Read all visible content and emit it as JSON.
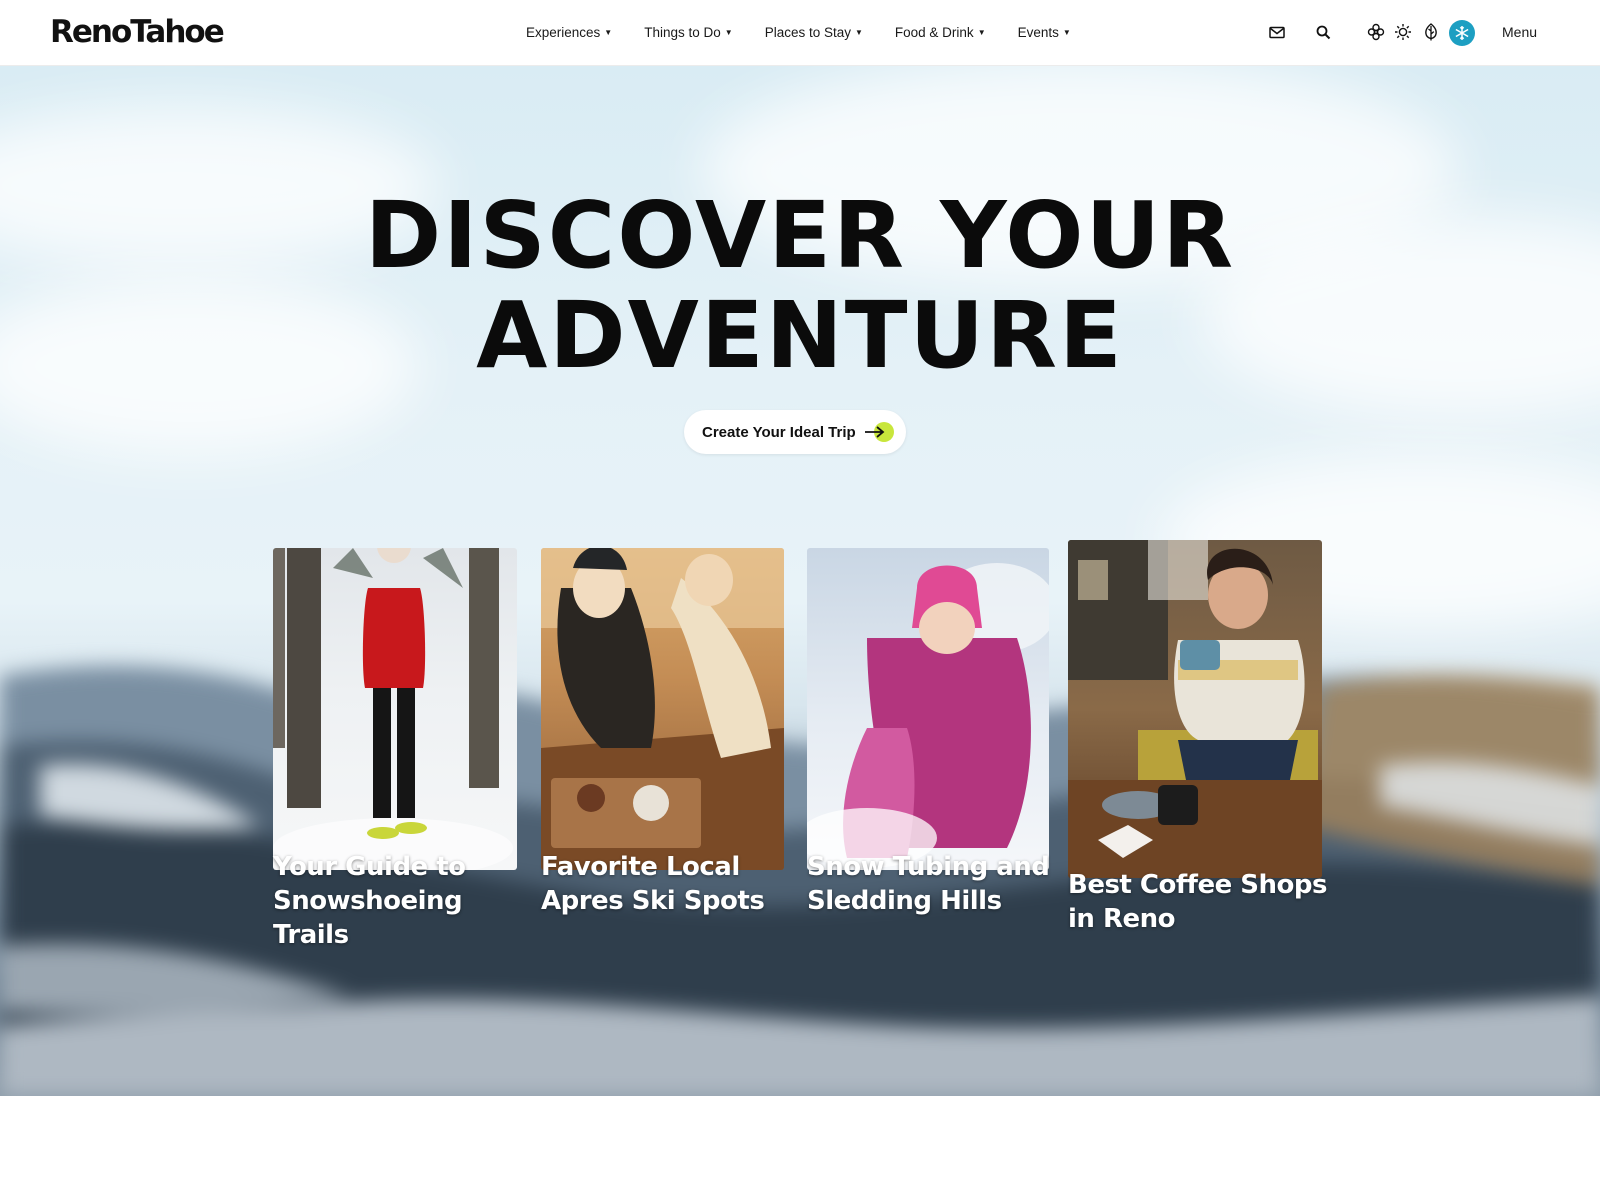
{
  "brand": {
    "logo_text": "RenoTahoe"
  },
  "nav": {
    "items": [
      {
        "label": "Experiences"
      },
      {
        "label": "Things to Do"
      },
      {
        "label": "Places to Stay"
      },
      {
        "label": "Food & Drink"
      },
      {
        "label": "Events"
      }
    ]
  },
  "header_icons": [
    "mail-icon",
    "search-icon",
    "flower-icon",
    "sun-icon",
    "leaf-icon",
    "snowflake-icon"
  ],
  "menu_label": "Menu",
  "hero": {
    "title_line1": "DISCOVER YOUR",
    "title_line2": "ADVENTURE",
    "cta_label": "Create Your Ideal Trip"
  },
  "cards": [
    {
      "title_line1": "Your Guide to",
      "title_line2": "Snowshoeing",
      "title_line3": "Trails"
    },
    {
      "title_line1": "Favorite Local",
      "title_line2": "Apres Ski Spots"
    },
    {
      "title_line1": "Snow Tubing and",
      "title_line2": "Sledding Hills"
    },
    {
      "title_line1": "Best Coffee Shops",
      "title_line2": "in Reno"
    }
  ],
  "colors": {
    "accent_season": "#1d9fc2",
    "cta_arrow_bg": "#c8e63c",
    "sky": "#e4f1f7"
  }
}
